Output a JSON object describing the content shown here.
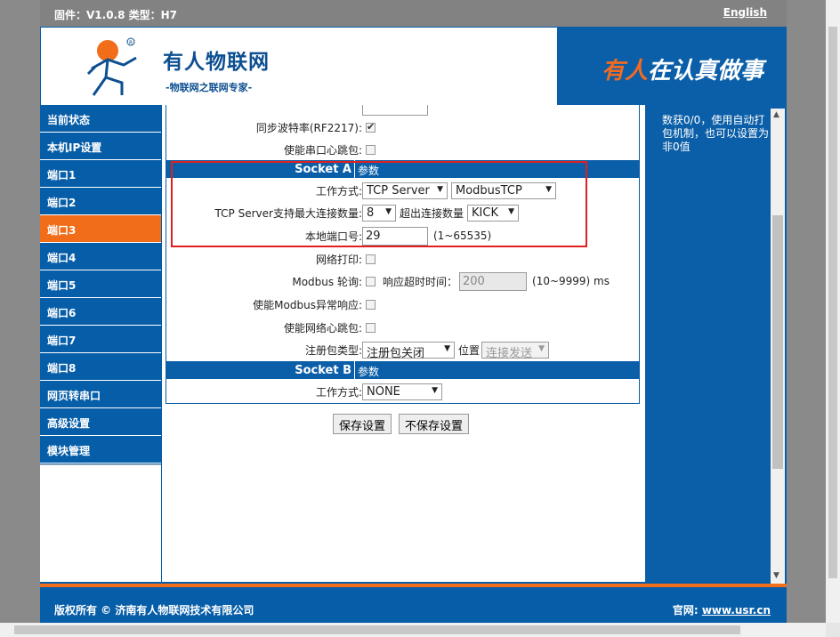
{
  "topbar": {
    "firmware": "固件：V1.0.8 类型：H7",
    "lang": "English"
  },
  "header": {
    "brand_name": "有人物联网",
    "brand_sub": "-物联网之联网专家-",
    "slogan_1": "有人",
    "slogan_2": "在认真做事"
  },
  "sidebar": {
    "items": [
      {
        "label": "当前状态"
      },
      {
        "label": "本机IP设置"
      },
      {
        "label": "端口1"
      },
      {
        "label": "端口2"
      },
      {
        "label": "端口3"
      },
      {
        "label": "端口4"
      },
      {
        "label": "端口5"
      },
      {
        "label": "端口6"
      },
      {
        "label": "端口7"
      },
      {
        "label": "端口8"
      },
      {
        "label": "网页转串口"
      },
      {
        "label": "高级设置"
      },
      {
        "label": "模块管理"
      }
    ],
    "active_index": 4
  },
  "form": {
    "sync_baud_label": "同步波特率(RF2217):",
    "serial_heartbeat_label": "使能串口心跳包:",
    "socket_a": {
      "name": "Socket A",
      "param": "参数"
    },
    "work_mode_label": "工作方式:",
    "work_mode_value": "TCP Server",
    "protocol_value": "ModbusTCP",
    "max_conn_label": "TCP Server支持最大连接数量:",
    "max_conn_value": "8",
    "exceed_label": "超出连接数量",
    "exceed_value": "KICK",
    "local_port_label": "本地端口号:",
    "local_port_value": "29",
    "local_port_range": "(1~65535)",
    "net_print_label": "网络打印:",
    "modbus_poll_label": "Modbus 轮询:",
    "resp_timeout_label": "响应超时时间：",
    "resp_timeout_value": "200",
    "resp_timeout_unit": "(10~9999) ms",
    "modbus_exc_label": "使能Modbus异常响应:",
    "net_heartbeat_label": "使能网络心跳包:",
    "reg_type_label": "注册包类型:",
    "reg_type_value": "注册包关闭",
    "position_label": "位置",
    "position_value": "连接发送",
    "socket_b": {
      "name": "Socket B",
      "param": "参数"
    },
    "work_mode_b_label": "工作方式:",
    "work_mode_b_value": "NONE"
  },
  "buttons": {
    "save": "保存设置",
    "nosave": "不保存设置"
  },
  "help": {
    "text": "数获0/0，使用自动打包机制，也可以设置为非0值"
  },
  "footer": {
    "copyright": "版权所有 © 济南有人物联网技术有限公司",
    "site_label": "官网:",
    "site_link": "www.usr.cn"
  },
  "colors": {
    "primary": "#075ea8",
    "accent": "#f16d1a",
    "highlight": "#e02020"
  }
}
